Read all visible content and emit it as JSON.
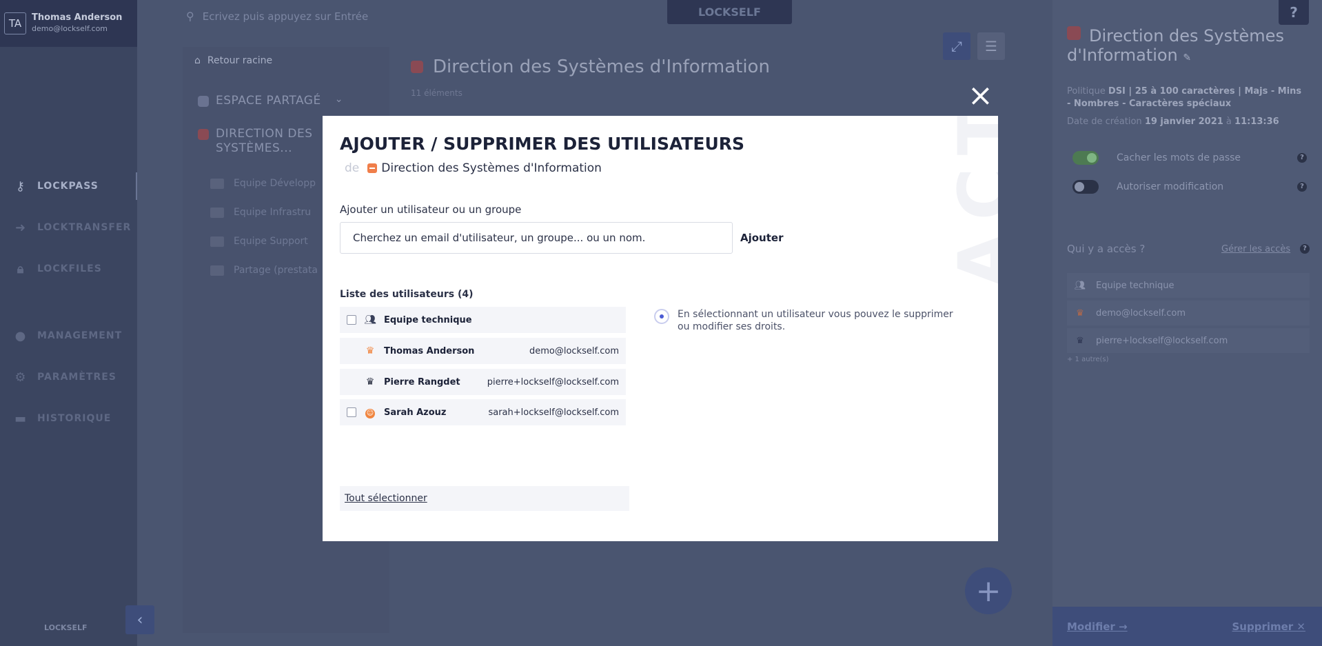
{
  "user": {
    "initials": "TA",
    "name": "Thomas Anderson",
    "email": "demo@lockself.com"
  },
  "nav": [
    {
      "label": "LOCKPASS",
      "icon": "key-icon"
    },
    {
      "label": "LOCKTRANSFER",
      "icon": "arrow-right-icon"
    },
    {
      "label": "LOCKFILES",
      "icon": "lock-icon"
    },
    {
      "label": "MANAGEMENT",
      "icon": "user-icon"
    },
    {
      "label": "PARAMÈTRES",
      "icon": "gears-icon"
    },
    {
      "label": "HISTORIQUE",
      "icon": "history-icon"
    }
  ],
  "footer_logo": "LOCKSELF",
  "search": {
    "placeholder": "Ecrivez puis appuyez sur Entrée"
  },
  "top_logo": "LOCKSELF",
  "tree": {
    "back": "Retour racine",
    "shared": "ESPACE PARTAGÉ",
    "dsi_line1": "DIRECTION DES",
    "dsi_line2": "SYSTÈMES...",
    "subs": [
      "Equipe Développ",
      "Equipe Infrastru",
      "Equipe Support",
      "Partage (prestata"
    ]
  },
  "content": {
    "title": "Direction des Systèmes d'Information",
    "count": "11 éléments"
  },
  "detail": {
    "title": "Direction des Systèmes d'Information",
    "policy_label": "Politique",
    "policy_value": "DSI | 25 à 100 caractères | Majs - Mins - Nombres - Caractères spéciaux",
    "created_label": "Date de création",
    "created_date": "19 janvier 2021",
    "created_at": "à",
    "created_time": "11:13:36",
    "toggle_hide": "Cacher les mots de passe",
    "toggle_allow": "Autoriser modification",
    "access_title": "Qui y a accès ?",
    "access_manage": "Gérer les accès",
    "access": [
      "Equipe technique",
      "demo@lockself.com",
      "pierre+lockself@lockself.com"
    ],
    "others": "+ 1 autre(s)",
    "modify": "Modifier →",
    "delete": "Supprimer ✕"
  },
  "modal": {
    "title": "AJOUTER / SUPPRIMER DES UTILISATEURS",
    "de": "de",
    "folder": "Direction des Systèmes d'Information",
    "add_label": "Ajouter un utilisateur ou un groupe",
    "search_placeholder": "Cherchez un email d'utilisateur, un groupe... ou un nom.",
    "add_button": "Ajouter",
    "list_title": "Liste des utilisateurs (4)",
    "rows": [
      {
        "name": "Equipe technique",
        "email": ""
      },
      {
        "name": "Thomas Anderson",
        "email": "demo@lockself.com"
      },
      {
        "name": "Pierre Rangdet",
        "email": "pierre+lockself@lockself.com"
      },
      {
        "name": "Sarah Azouz",
        "email": "sarah+lockself@lockself.com"
      }
    ],
    "info": "En sélectionnant un utilisateur vous pouvez le supprimer ou modifier ses droits.",
    "select_all": "Tout sélectionner",
    "watermark": "ACTION"
  }
}
